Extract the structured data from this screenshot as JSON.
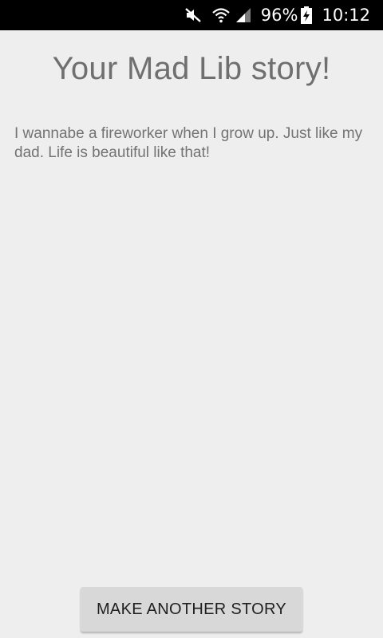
{
  "status_bar": {
    "battery_text": "96%",
    "time": "10:12",
    "icons": [
      "mute-icon",
      "wifi-icon",
      "signal-icon",
      "battery-charging-icon"
    ]
  },
  "screen": {
    "title": "Your Mad Lib story!",
    "story": "I wannabe a fireworker when I grow up. Just like my dad. Life is beautiful like that!",
    "button_label": "MAKE ANOTHER STORY"
  },
  "colors": {
    "background": "#eeeeee",
    "status_bar": "#000000",
    "title_text": "#6f6f6f",
    "button_bg": "#d8d8d8"
  }
}
